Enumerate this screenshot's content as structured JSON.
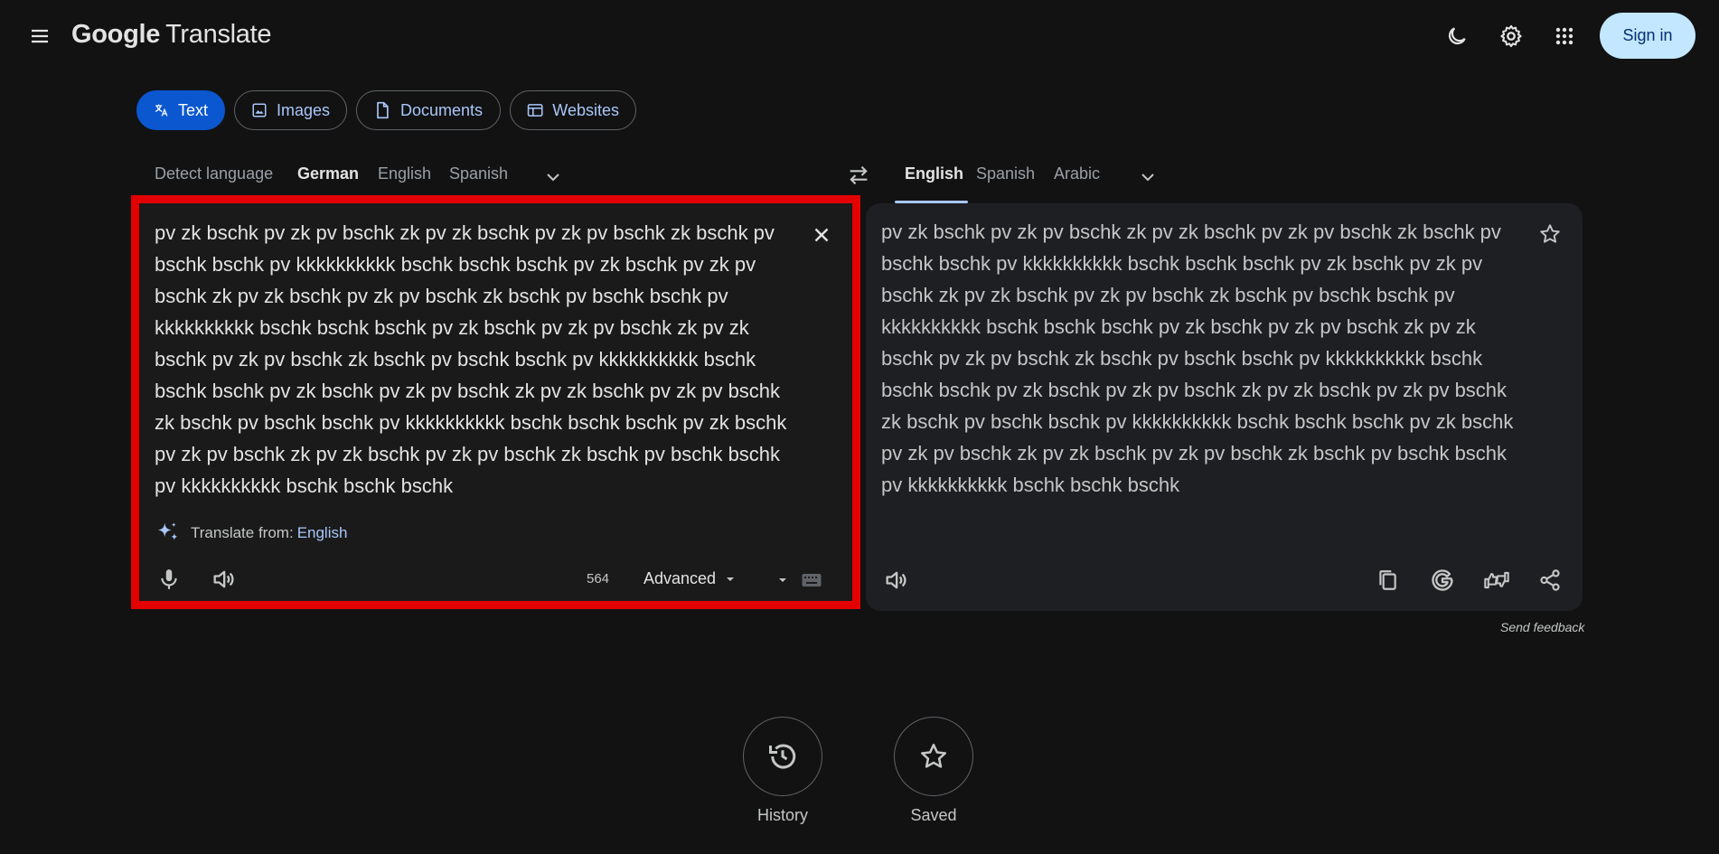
{
  "header": {
    "logo_google": "Google",
    "logo_translate": "Translate",
    "signin_label": "Sign in",
    "icons": [
      "menu-icon",
      "dark-mode-icon",
      "settings-icon",
      "apps-grid-icon"
    ]
  },
  "modes": [
    {
      "label": "Text",
      "icon": "translate-icon",
      "active": true
    },
    {
      "label": "Images",
      "icon": "image-icon",
      "active": false
    },
    {
      "label": "Documents",
      "icon": "document-icon",
      "active": false
    },
    {
      "label": "Websites",
      "icon": "website-icon",
      "active": false
    }
  ],
  "source_langs": [
    "Detect language",
    "German",
    "English",
    "Spanish"
  ],
  "target_langs": [
    "English",
    "Spanish",
    "Arabic"
  ],
  "source": {
    "text": "pv zk bschk pv zk pv bschk zk pv zk bschk pv zk pv bschk zk bschk pv bschk bschk pv kkkkkkkkkk bschk bschk bschk pv zk bschk pv zk pv bschk zk pv zk bschk pv zk pv bschk zk bschk pv bschk bschk pv kkkkkkkkkk bschk bschk bschk pv zk bschk pv zk pv bschk zk pv zk bschk pv zk pv bschk zk bschk pv bschk bschk pv kkkkkkkkkk bschk bschk bschk pv zk bschk pv zk pv bschk zk pv zk bschk pv zk pv bschk zk bschk pv bschk bschk pv kkkkkkkkkk bschk bschk bschk pv zk bschk pv zk pv bschk zk pv zk bschk pv zk pv bschk zk bschk pv bschk bschk pv kkkkkkkkkk bschk bschk bschk",
    "translate_from_label": "Translate from:",
    "translate_from_lang": "English",
    "char_count": "564",
    "advanced_label": "Advanced"
  },
  "target": {
    "text": "pv zk bschk pv zk pv bschk zk pv zk bschk pv zk pv bschk zk bschk pv bschk bschk pv kkkkkkkkkk bschk bschk bschk pv zk bschk pv zk pv bschk zk pv zk bschk pv zk pv bschk zk bschk pv bschk bschk pv kkkkkkkkkk bschk bschk bschk pv zk bschk pv zk pv bschk zk pv zk bschk pv zk pv bschk zk bschk pv bschk bschk pv kkkkkkkkkk bschk bschk bschk pv zk bschk pv zk pv bschk zk pv zk bschk pv zk pv bschk zk bschk pv bschk bschk pv kkkkkkkkkk bschk bschk bschk pv zk bschk pv zk pv bschk zk pv zk bschk pv zk pv bschk zk bschk pv bschk bschk pv kkkkkkkkkk bschk bschk bschk"
  },
  "feedback_label": "Send feedback",
  "bottom": {
    "history_label": "History",
    "saved_label": "Saved"
  },
  "colors": {
    "background": "#121212",
    "accent": "#0b57d0",
    "highlight_border": "#e30000",
    "signin_bg": "#c2e7ff"
  }
}
